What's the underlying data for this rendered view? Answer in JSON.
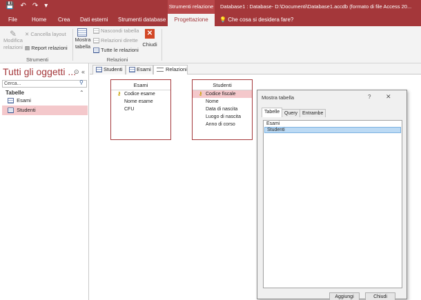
{
  "titlebar": {
    "context_group": "Strumenti relazione",
    "document_title": "Database1 : Database- D:\\Documenti\\Database1.accdb (formato di file Access 20..."
  },
  "tabs": [
    "File",
    "Home",
    "Crea",
    "Dati esterni",
    "Strumenti database",
    "Progettazione"
  ],
  "tell_me": "Che cosa si desidera fare?",
  "ribbon": {
    "strumenti": {
      "modifica_line1": "Modifica",
      "modifica_line2": "relazioni",
      "cancella_layout": "Cancella layout",
      "report_relazioni": "Report relazioni",
      "label": "Strumenti"
    },
    "relazioni": {
      "mostra_line1": "Mostra",
      "mostra_line2": "tabella",
      "nascondi_tabella": "Nascondi tabella",
      "relazioni_dirette": "Relazioni dirette",
      "tutte_relazioni": "Tutte le relazioni",
      "chiudi": "Chiudi",
      "label": "Relazioni"
    }
  },
  "nav": {
    "title": "Tutti gli oggetti ...",
    "search_placeholder": "Cerca...",
    "section": "Tabelle",
    "items": [
      {
        "label": "Esami",
        "selected": false
      },
      {
        "label": "Studenti",
        "selected": true
      }
    ]
  },
  "doc_tabs": [
    "Studenti",
    "Esami",
    "Relazioni"
  ],
  "relationship_tables": {
    "esami": {
      "title": "Esami",
      "fields": [
        "Codice esame",
        "Nome esame",
        "CFU"
      ]
    },
    "studenti": {
      "title": "Studenti",
      "fields": [
        "Codice fiscale",
        "Nome",
        "Data di nascita",
        "Luogo di nascita",
        "Anno di corso"
      ]
    }
  },
  "dialog": {
    "title": "Mostra tabella",
    "help": "?",
    "close": "✕",
    "tabs": [
      "Tabelle",
      "Query",
      "Entrambe"
    ],
    "list": [
      "Esami",
      "Studenti"
    ],
    "selected_item": "Studenti",
    "add_button": "Aggiungi",
    "close_button": "Chiudi"
  },
  "colors": {
    "accent": "#a4373a",
    "selection": "#f4c8cb",
    "list_selection": "#bcdaf4"
  }
}
